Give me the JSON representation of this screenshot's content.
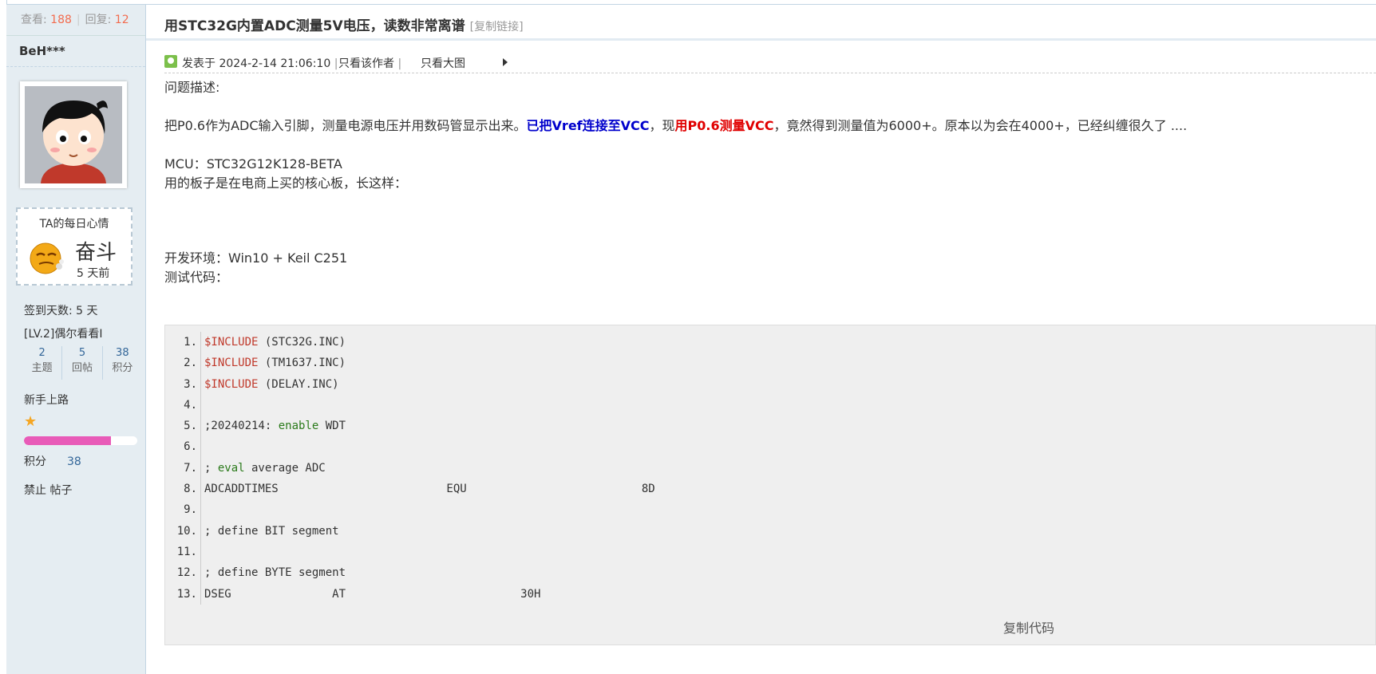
{
  "sidebar": {
    "views_label": "查看:",
    "views_count": "188",
    "replies_label": "回复:",
    "replies_count": "12",
    "author": "BeH***",
    "mood_title": "TA的每日心情",
    "mood_text": "奋斗",
    "mood_time": "5 天前",
    "signin": "签到天数: 5 天",
    "level": "[LV.2]偶尔看看I",
    "stats": [
      {
        "num": "2",
        "label": "主题"
      },
      {
        "num": "5",
        "label": "回帖"
      },
      {
        "num": "38",
        "label": "积分"
      }
    ],
    "rank": "新手上路",
    "rank_progress": 0.77,
    "points_label": "积分",
    "points_value": "38",
    "ban_post": "禁止 帖子"
  },
  "post": {
    "title": "用STC32G内置ADC测量5V电压，读数非常离谱",
    "copy_link": "[复制链接]",
    "posted_at": "发表于 2024-2-14 21:06:10",
    "only_author": "只看该作者",
    "only_big_image": "只看大图",
    "problem_label": "问题描述:",
    "para1_a": "把P0.6作为ADC输入引脚，测量电源电压并用数码管显示出来。",
    "para1_blue": "已把Vref连接至VCC",
    "para1_b": "，现",
    "para1_red": "用P0.6测量VCC",
    "para1_c": "，竟然得到测量值为6000+。原本以为会在4000+，已经纠缠很久了 ....",
    "mcu": "MCU：STC32G12K128-BETA",
    "board": "用的板子是在电商上买的核心板，长这样：",
    "env": "开发环境：Win10 + Keil  C251",
    "test_code": "测试代码："
  },
  "code": {
    "lines": [
      {
        "n": "1.",
        "parts": [
          {
            "t": "$INCLUDE",
            "c": "kw"
          },
          {
            "t": " (STC32G.INC)",
            "c": ""
          }
        ]
      },
      {
        "n": "2.",
        "parts": [
          {
            "t": "$INCLUDE",
            "c": "kw"
          },
          {
            "t": " (TM1637.INC)",
            "c": ""
          }
        ]
      },
      {
        "n": "3.",
        "parts": [
          {
            "t": "$INCLUDE",
            "c": "kw"
          },
          {
            "t": " (DELAY.INC)",
            "c": ""
          }
        ]
      },
      {
        "n": "4.",
        "parts": []
      },
      {
        "n": "5.",
        "parts": [
          {
            "t": ";20240214: ",
            "c": ""
          },
          {
            "t": "enable",
            "c": "gn"
          },
          {
            "t": " WDT",
            "c": ""
          }
        ]
      },
      {
        "n": "6.",
        "parts": []
      },
      {
        "n": "7.",
        "parts": [
          {
            "t": "; ",
            "c": ""
          },
          {
            "t": "eval",
            "c": "gn"
          },
          {
            "t": " average ADC",
            "c": ""
          }
        ]
      },
      {
        "n": "8.",
        "parts": [
          {
            "t": "ADCADDTIMES                         EQU                          8D",
            "c": ""
          }
        ]
      },
      {
        "n": "9.",
        "parts": []
      },
      {
        "n": "10.",
        "parts": [
          {
            "t": "; define BIT segment",
            "c": ""
          }
        ]
      },
      {
        "n": "11.",
        "parts": []
      },
      {
        "n": "12.",
        "parts": [
          {
            "t": "; define BYTE segment",
            "c": ""
          }
        ]
      },
      {
        "n": "13.",
        "parts": [
          {
            "t": "DSEG               AT                          30H",
            "c": ""
          }
        ]
      }
    ],
    "copy_code": "复制代码"
  }
}
